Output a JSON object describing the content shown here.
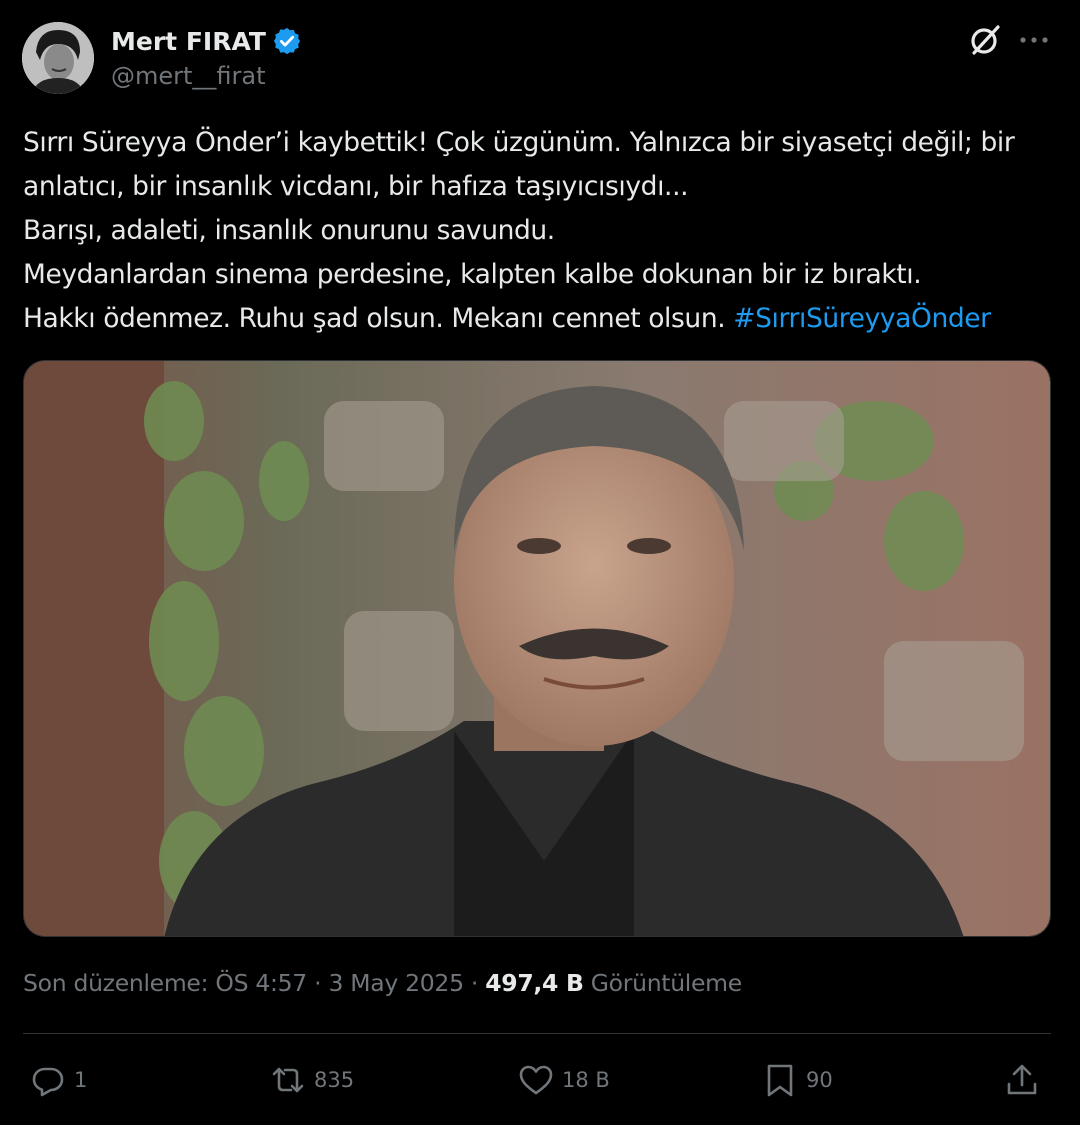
{
  "author": {
    "name": "Mert FIRAT",
    "handle": "@mert__firat"
  },
  "tweet": {
    "lines": [
      "Sırrı Süreyya Önder’i kaybettik! Çok üzgünüm. Yalnızca bir siyasetçi değil; bir",
      "anlatıcı, bir insanlık vicdanı, bir hafıza taşıyıcısıydı...",
      "Barışı, adaleti, insanlık onurunu savundu.",
      "Meydanlardan sinema perdesine, kalpten kalbe dokunan bir iz bıraktı.",
      "Hakkı ödenmez. Ruhu şad olsun. Mekanı cennet olsun. "
    ],
    "hashtag": "#SırrıSüreyyaÖnder"
  },
  "meta": {
    "edited_label": "Son düzenleme: ÖS 4:57",
    "separator": "·",
    "date": "3 May 2025",
    "views_count": "497,4 B",
    "views_label": "Görüntüleme"
  },
  "actions": {
    "reply_count": "1",
    "retweet_count": "835",
    "like_count": "18 B",
    "bookmark_count": "90"
  },
  "icons": {
    "verified": "verified-badge-icon",
    "grok": "grok-icon",
    "more": "more-icon",
    "reply": "reply-icon",
    "retweet": "retweet-icon",
    "like": "heart-icon",
    "bookmark": "bookmark-icon",
    "share": "share-icon"
  },
  "colors": {
    "background": "#000000",
    "text": "#e7e9ea",
    "secondary": "#71767b",
    "accent": "#1d9bf0"
  }
}
